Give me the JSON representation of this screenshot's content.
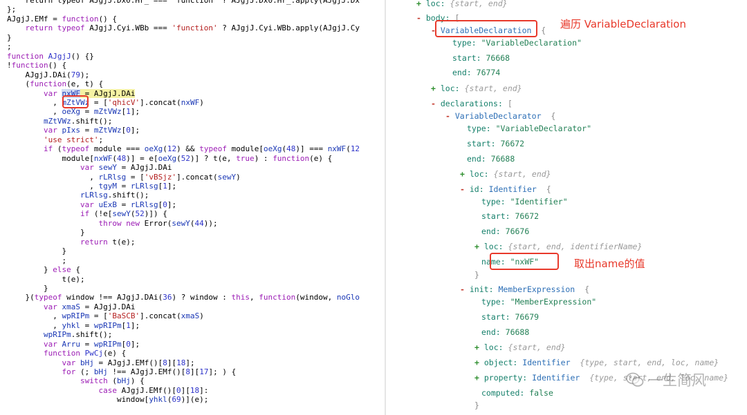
{
  "code_lines": [
    {
      "segments": [
        {
          "t": "    return typeof AJgjJ.Dx0.Hr_ === 'function' ? AJgjJ.Dx0.Hr_.apply(AJgjJ.Dx"
        }
      ]
    },
    {
      "segments": [
        {
          "t": "};"
        }
      ]
    },
    {
      "segments": [
        {
          "t": "AJgjJ.EMf = "
        },
        {
          "t": "function",
          "c": "kw"
        },
        {
          "t": "() {"
        }
      ]
    },
    {
      "segments": [
        {
          "t": "    "
        },
        {
          "t": "return typeof",
          "c": "kw"
        },
        {
          "t": " AJgjJ.Cyi.WBb === "
        },
        {
          "t": "'function'",
          "c": "str"
        },
        {
          "t": " ? AJgjJ.Cyi.WBb.apply(AJgjJ.Cy"
        }
      ]
    },
    {
      "segments": [
        {
          "t": "}"
        }
      ]
    },
    {
      "segments": [
        {
          "t": ";"
        }
      ]
    },
    {
      "segments": [
        {
          "t": "function",
          "c": "kw"
        },
        {
          "t": " "
        },
        {
          "t": "AJgjJ",
          "c": "fn"
        },
        {
          "t": "() {}"
        }
      ]
    },
    {
      "segments": [
        {
          "t": "!"
        },
        {
          "t": "function",
          "c": "kw"
        },
        {
          "t": "() {"
        }
      ]
    },
    {
      "segments": [
        {
          "t": "    AJgjJ.DAi("
        },
        {
          "t": "79",
          "c": "num"
        },
        {
          "t": ");"
        }
      ]
    },
    {
      "segments": [
        {
          "t": "    ("
        },
        {
          "t": "function",
          "c": "kw"
        },
        {
          "t": "(e, t) {"
        }
      ]
    },
    {
      "segments": [
        {
          "t": "        "
        },
        {
          "t": "var",
          "c": "kw"
        },
        {
          "t": " "
        },
        {
          "t": "nxWF",
          "c": "sel"
        },
        {
          "t": " = AJgjJ.DAi",
          "c": "hl"
        }
      ]
    },
    {
      "segments": [
        {
          "t": "          , "
        },
        {
          "t": "mZtVWz",
          "c": "id"
        },
        {
          "t": " = ["
        },
        {
          "t": "'qhicV'",
          "c": "str"
        },
        {
          "t": "].concat("
        },
        {
          "t": "nxWF",
          "c": "id"
        },
        {
          "t": ")"
        }
      ]
    },
    {
      "segments": [
        {
          "t": "          , "
        },
        {
          "t": "oeXg",
          "c": "id"
        },
        {
          "t": " = "
        },
        {
          "t": "mZtVWz",
          "c": "id"
        },
        {
          "t": "["
        },
        {
          "t": "1",
          "c": "num"
        },
        {
          "t": "];"
        }
      ]
    },
    {
      "segments": [
        {
          "t": "        "
        },
        {
          "t": "mZtVWz",
          "c": "id"
        },
        {
          "t": ".shift();"
        }
      ]
    },
    {
      "segments": [
        {
          "t": "        "
        },
        {
          "t": "var",
          "c": "kw"
        },
        {
          "t": " "
        },
        {
          "t": "pIxs",
          "c": "id"
        },
        {
          "t": " = "
        },
        {
          "t": "mZtVWz",
          "c": "id"
        },
        {
          "t": "["
        },
        {
          "t": "0",
          "c": "num"
        },
        {
          "t": "];"
        }
      ]
    },
    {
      "segments": [
        {
          "t": "        "
        },
        {
          "t": "'use strict'",
          "c": "str"
        },
        {
          "t": ";"
        }
      ]
    },
    {
      "segments": [
        {
          "t": "        "
        },
        {
          "t": "if",
          "c": "kw"
        },
        {
          "t": " ("
        },
        {
          "t": "typeof",
          "c": "kw"
        },
        {
          "t": " module === "
        },
        {
          "t": "oeXg",
          "c": "id"
        },
        {
          "t": "("
        },
        {
          "t": "12",
          "c": "num"
        },
        {
          "t": ") && "
        },
        {
          "t": "typeof",
          "c": "kw"
        },
        {
          "t": " module["
        },
        {
          "t": "oeXg",
          "c": "id"
        },
        {
          "t": "("
        },
        {
          "t": "48",
          "c": "num"
        },
        {
          "t": ")] === "
        },
        {
          "t": "nxWF",
          "c": "id"
        },
        {
          "t": "("
        },
        {
          "t": "12",
          "c": "num"
        }
      ]
    },
    {
      "segments": [
        {
          "t": "            module["
        },
        {
          "t": "nxWF",
          "c": "id"
        },
        {
          "t": "("
        },
        {
          "t": "48",
          "c": "num"
        },
        {
          "t": ")] = e["
        },
        {
          "t": "oeXg",
          "c": "id"
        },
        {
          "t": "("
        },
        {
          "t": "52",
          "c": "num"
        },
        {
          "t": ")] ? t(e, "
        },
        {
          "t": "true",
          "c": "kw"
        },
        {
          "t": ") : "
        },
        {
          "t": "function",
          "c": "kw"
        },
        {
          "t": "(e) {"
        }
      ]
    },
    {
      "segments": [
        {
          "t": "                "
        },
        {
          "t": "var",
          "c": "kw"
        },
        {
          "t": " "
        },
        {
          "t": "sewY",
          "c": "id"
        },
        {
          "t": " = AJgjJ.DAi"
        }
      ]
    },
    {
      "segments": [
        {
          "t": "                  , "
        },
        {
          "t": "rLRlsg",
          "c": "id"
        },
        {
          "t": " = ["
        },
        {
          "t": "'vBSjz'",
          "c": "str"
        },
        {
          "t": "].concat("
        },
        {
          "t": "sewY",
          "c": "id"
        },
        {
          "t": ")"
        }
      ]
    },
    {
      "segments": [
        {
          "t": "                  , "
        },
        {
          "t": "tgyM",
          "c": "id"
        },
        {
          "t": " = "
        },
        {
          "t": "rLRlsg",
          "c": "id"
        },
        {
          "t": "["
        },
        {
          "t": "1",
          "c": "num"
        },
        {
          "t": "];"
        }
      ]
    },
    {
      "segments": [
        {
          "t": "                "
        },
        {
          "t": "rLRlsg",
          "c": "id"
        },
        {
          "t": ".shift();"
        }
      ]
    },
    {
      "segments": [
        {
          "t": "                "
        },
        {
          "t": "var",
          "c": "kw"
        },
        {
          "t": " "
        },
        {
          "t": "uExB",
          "c": "id"
        },
        {
          "t": " = "
        },
        {
          "t": "rLRlsg",
          "c": "id"
        },
        {
          "t": "["
        },
        {
          "t": "0",
          "c": "num"
        },
        {
          "t": "];"
        }
      ]
    },
    {
      "segments": [
        {
          "t": "                "
        },
        {
          "t": "if",
          "c": "kw"
        },
        {
          "t": " (!e["
        },
        {
          "t": "sewY",
          "c": "id"
        },
        {
          "t": "("
        },
        {
          "t": "52",
          "c": "num"
        },
        {
          "t": ")]) {"
        }
      ]
    },
    {
      "segments": [
        {
          "t": "                    "
        },
        {
          "t": "throw new",
          "c": "kw"
        },
        {
          "t": " Error("
        },
        {
          "t": "sewY",
          "c": "id"
        },
        {
          "t": "("
        },
        {
          "t": "44",
          "c": "num"
        },
        {
          "t": "));"
        }
      ]
    },
    {
      "segments": [
        {
          "t": "                }"
        }
      ]
    },
    {
      "segments": [
        {
          "t": "                "
        },
        {
          "t": "return",
          "c": "kw"
        },
        {
          "t": " t(e);"
        }
      ]
    },
    {
      "segments": [
        {
          "t": "            }"
        }
      ]
    },
    {
      "segments": [
        {
          "t": "            ;"
        }
      ]
    },
    {
      "segments": [
        {
          "t": "        } "
        },
        {
          "t": "else",
          "c": "kw"
        },
        {
          "t": " {"
        }
      ]
    },
    {
      "segments": [
        {
          "t": "            t(e);"
        }
      ]
    },
    {
      "segments": [
        {
          "t": "        }"
        }
      ]
    },
    {
      "segments": [
        {
          "t": "    }("
        },
        {
          "t": "typeof",
          "c": "kw"
        },
        {
          "t": " window !== AJgjJ.DAi("
        },
        {
          "t": "36",
          "c": "num"
        },
        {
          "t": ") ? window : "
        },
        {
          "t": "this",
          "c": "kw"
        },
        {
          "t": ", "
        },
        {
          "t": "function",
          "c": "kw"
        },
        {
          "t": "(window, "
        },
        {
          "t": "noGlo",
          "c": "id"
        }
      ]
    },
    {
      "segments": [
        {
          "t": "        "
        },
        {
          "t": "var",
          "c": "kw"
        },
        {
          "t": " "
        },
        {
          "t": "xmaS",
          "c": "id"
        },
        {
          "t": " = AJgjJ.DAi"
        }
      ]
    },
    {
      "segments": [
        {
          "t": "          , "
        },
        {
          "t": "wpRIPm",
          "c": "id"
        },
        {
          "t": " = ["
        },
        {
          "t": "'BaSCB'",
          "c": "str"
        },
        {
          "t": "].concat("
        },
        {
          "t": "xmaS",
          "c": "id"
        },
        {
          "t": ")"
        }
      ]
    },
    {
      "segments": [
        {
          "t": "          , "
        },
        {
          "t": "yhkl",
          "c": "id"
        },
        {
          "t": " = "
        },
        {
          "t": "wpRIPm",
          "c": "id"
        },
        {
          "t": "["
        },
        {
          "t": "1",
          "c": "num"
        },
        {
          "t": "];"
        }
      ]
    },
    {
      "segments": [
        {
          "t": "        "
        },
        {
          "t": "wpRIPm",
          "c": "id"
        },
        {
          "t": ".shift();"
        }
      ]
    },
    {
      "segments": [
        {
          "t": "        "
        },
        {
          "t": "var",
          "c": "kw"
        },
        {
          "t": " "
        },
        {
          "t": "Arru",
          "c": "id"
        },
        {
          "t": " = "
        },
        {
          "t": "wpRIPm",
          "c": "id"
        },
        {
          "t": "["
        },
        {
          "t": "0",
          "c": "num"
        },
        {
          "t": "];"
        }
      ]
    },
    {
      "segments": [
        {
          "t": "        "
        },
        {
          "t": "function",
          "c": "kw"
        },
        {
          "t": " "
        },
        {
          "t": "PwCj",
          "c": "fn"
        },
        {
          "t": "(e) {"
        }
      ]
    },
    {
      "segments": [
        {
          "t": "            "
        },
        {
          "t": "var",
          "c": "kw"
        },
        {
          "t": " "
        },
        {
          "t": "bHj",
          "c": "id"
        },
        {
          "t": " = AJgjJ.EMf()["
        },
        {
          "t": "8",
          "c": "num"
        },
        {
          "t": "]["
        },
        {
          "t": "18",
          "c": "num"
        },
        {
          "t": "];"
        }
      ]
    },
    {
      "segments": [
        {
          "t": "            "
        },
        {
          "t": "for",
          "c": "kw"
        },
        {
          "t": " (; "
        },
        {
          "t": "bHj",
          "c": "id"
        },
        {
          "t": " !== AJgjJ.EMf()["
        },
        {
          "t": "8",
          "c": "num"
        },
        {
          "t": "]["
        },
        {
          "t": "17",
          "c": "num"
        },
        {
          "t": "]; ) {"
        }
      ]
    },
    {
      "segments": [
        {
          "t": "                "
        },
        {
          "t": "switch",
          "c": "kw"
        },
        {
          "t": " ("
        },
        {
          "t": "bHj",
          "c": "id"
        },
        {
          "t": ") {"
        }
      ]
    },
    {
      "segments": [
        {
          "t": "                    "
        },
        {
          "t": "case",
          "c": "kw"
        },
        {
          "t": " AJgjJ.EMf()["
        },
        {
          "t": "0",
          "c": "num"
        },
        {
          "t": "]["
        },
        {
          "t": "18",
          "c": "num"
        },
        {
          "t": "]:"
        }
      ]
    },
    {
      "segments": [
        {
          "t": "                        window["
        },
        {
          "t": "yhkl",
          "c": "id"
        },
        {
          "t": "("
        },
        {
          "t": "69",
          "c": "num"
        },
        {
          "t": ")](e);"
        }
      ]
    }
  ],
  "tree_rows": [
    {
      "toggle": "+",
      "key": "loc",
      "summary": "{start, end}"
    },
    {
      "toggle": "-",
      "key": "body",
      "brace": "["
    },
    {
      "toggle": "-",
      "type": "VariableDeclaration",
      "brace": "{"
    },
    {
      "key": "type",
      "str": "\"VariableDeclaration\""
    },
    {
      "key": "start",
      "num": "76668"
    },
    {
      "key": "end",
      "num": "76774"
    },
    {
      "toggle": "+",
      "key": "loc",
      "summary": "{start, end}"
    },
    {
      "toggle": "-",
      "key": "declarations",
      "brace": "["
    },
    {
      "toggle": "-",
      "type": "VariableDeclarator",
      "brace": "{"
    },
    {
      "key": "type",
      "str": "\"VariableDeclarator\""
    },
    {
      "key": "start",
      "num": "76672"
    },
    {
      "key": "end",
      "num": "76688"
    },
    {
      "toggle": "+",
      "key": "loc",
      "summary": "{start, end}"
    },
    {
      "toggle": "-",
      "key": "id",
      "type": "Identifier",
      "brace": "{"
    },
    {
      "key": "type",
      "str": "\"Identifier\""
    },
    {
      "key": "start",
      "num": "76672"
    },
    {
      "key": "end",
      "num": "76676"
    },
    {
      "toggle": "+",
      "key": "loc",
      "summary": "{start, end, identifierName}"
    },
    {
      "key": "name",
      "str": "\"nxWF\""
    },
    {
      "brace": "}"
    },
    {
      "toggle": "-",
      "key": "init",
      "type": "MemberExpression",
      "brace": "{"
    },
    {
      "key": "type",
      "str": "\"MemberExpression\""
    },
    {
      "key": "start",
      "num": "76679"
    },
    {
      "key": "end",
      "num": "76688"
    },
    {
      "toggle": "+",
      "key": "loc",
      "summary": "{start, end}"
    },
    {
      "toggle": "+",
      "key": "object",
      "type": "Identifier",
      "summary": "{type, start, end, loc, name}"
    },
    {
      "toggle": "+",
      "key": "property",
      "type": "Identifier",
      "summary": "{type, start, end, loc, name}"
    },
    {
      "key": "computed",
      "num": "false"
    },
    {
      "brace": "}"
    }
  ],
  "annotations": {
    "traverse_label": "遍历 VariableDeclaration",
    "name_label": "取出name的值"
  },
  "watermark": {
    "text": "一生简风"
  },
  "colors": {
    "annotation_red": "#e8392b",
    "highlight_yellow": "#fbf7b5",
    "string_green": "#238056",
    "type_blue": "#2d6fb6",
    "keyword_purple": "#9c1db5"
  }
}
